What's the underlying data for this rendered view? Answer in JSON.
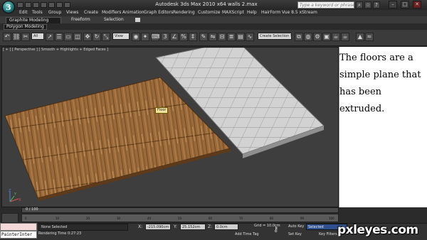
{
  "window": {
    "title": "Autodesk 3ds Max  2010 x64     walls 2.max",
    "search_placeholder": "Type a keyword or phrase"
  },
  "menu": [
    "Edit",
    "Tools",
    "Group",
    "Views",
    "Create",
    "Modifiers",
    "Animation",
    "Graph Editors",
    "Rendering",
    "Customize",
    "MAXScript",
    "Help",
    "HairForm",
    "Vue 8.5 xStream"
  ],
  "ribbon": {
    "tabs": [
      "Graphite Modeling Tools",
      "Freeform",
      "Selection"
    ],
    "panel_label": "Polygon Modeling"
  },
  "toolbar": {
    "filter_value": "All",
    "ref_coord_value": "View",
    "selection_set_value": "Create Selection S"
  },
  "viewport": {
    "label": "[ + ] [ Perspective ] [ Smooth + Highlights + Edged Faces ]",
    "object_tag": "Floor",
    "axes": [
      "X",
      "Y",
      "Z"
    ]
  },
  "note": {
    "text": "The floors are a simple plane that has been extruded."
  },
  "timeline": {
    "slider_label": "0 / 100",
    "ticks": [
      "0",
      "10",
      "20",
      "30",
      "40",
      "50",
      "60",
      "70",
      "80",
      "90",
      "100"
    ]
  },
  "status": {
    "maxscript_value": "PainterInter",
    "selection_text": "None Selected",
    "render_time": "Rendering Time  0:27:23",
    "x_label": "X:",
    "x_value": "-215.090cm",
    "y_label": "Y:",
    "y_value": "25.152cm",
    "z_label": "Z:",
    "z_value": "0.0cm",
    "grid": "Grid = 10.0cm",
    "add_time_tag": "Add Time Tag",
    "auto_key": "Auto Key",
    "set_key": "Set Key",
    "selected_value": "Selected",
    "key_filters": "Key Filters..."
  },
  "watermark": "pxleyes.com",
  "colors": {
    "wood_floor": "#9a6a3a",
    "tile_floor": "#cfcfcf",
    "viewport_bg": "#3e3e3e",
    "note_bg": "#ffffff"
  }
}
